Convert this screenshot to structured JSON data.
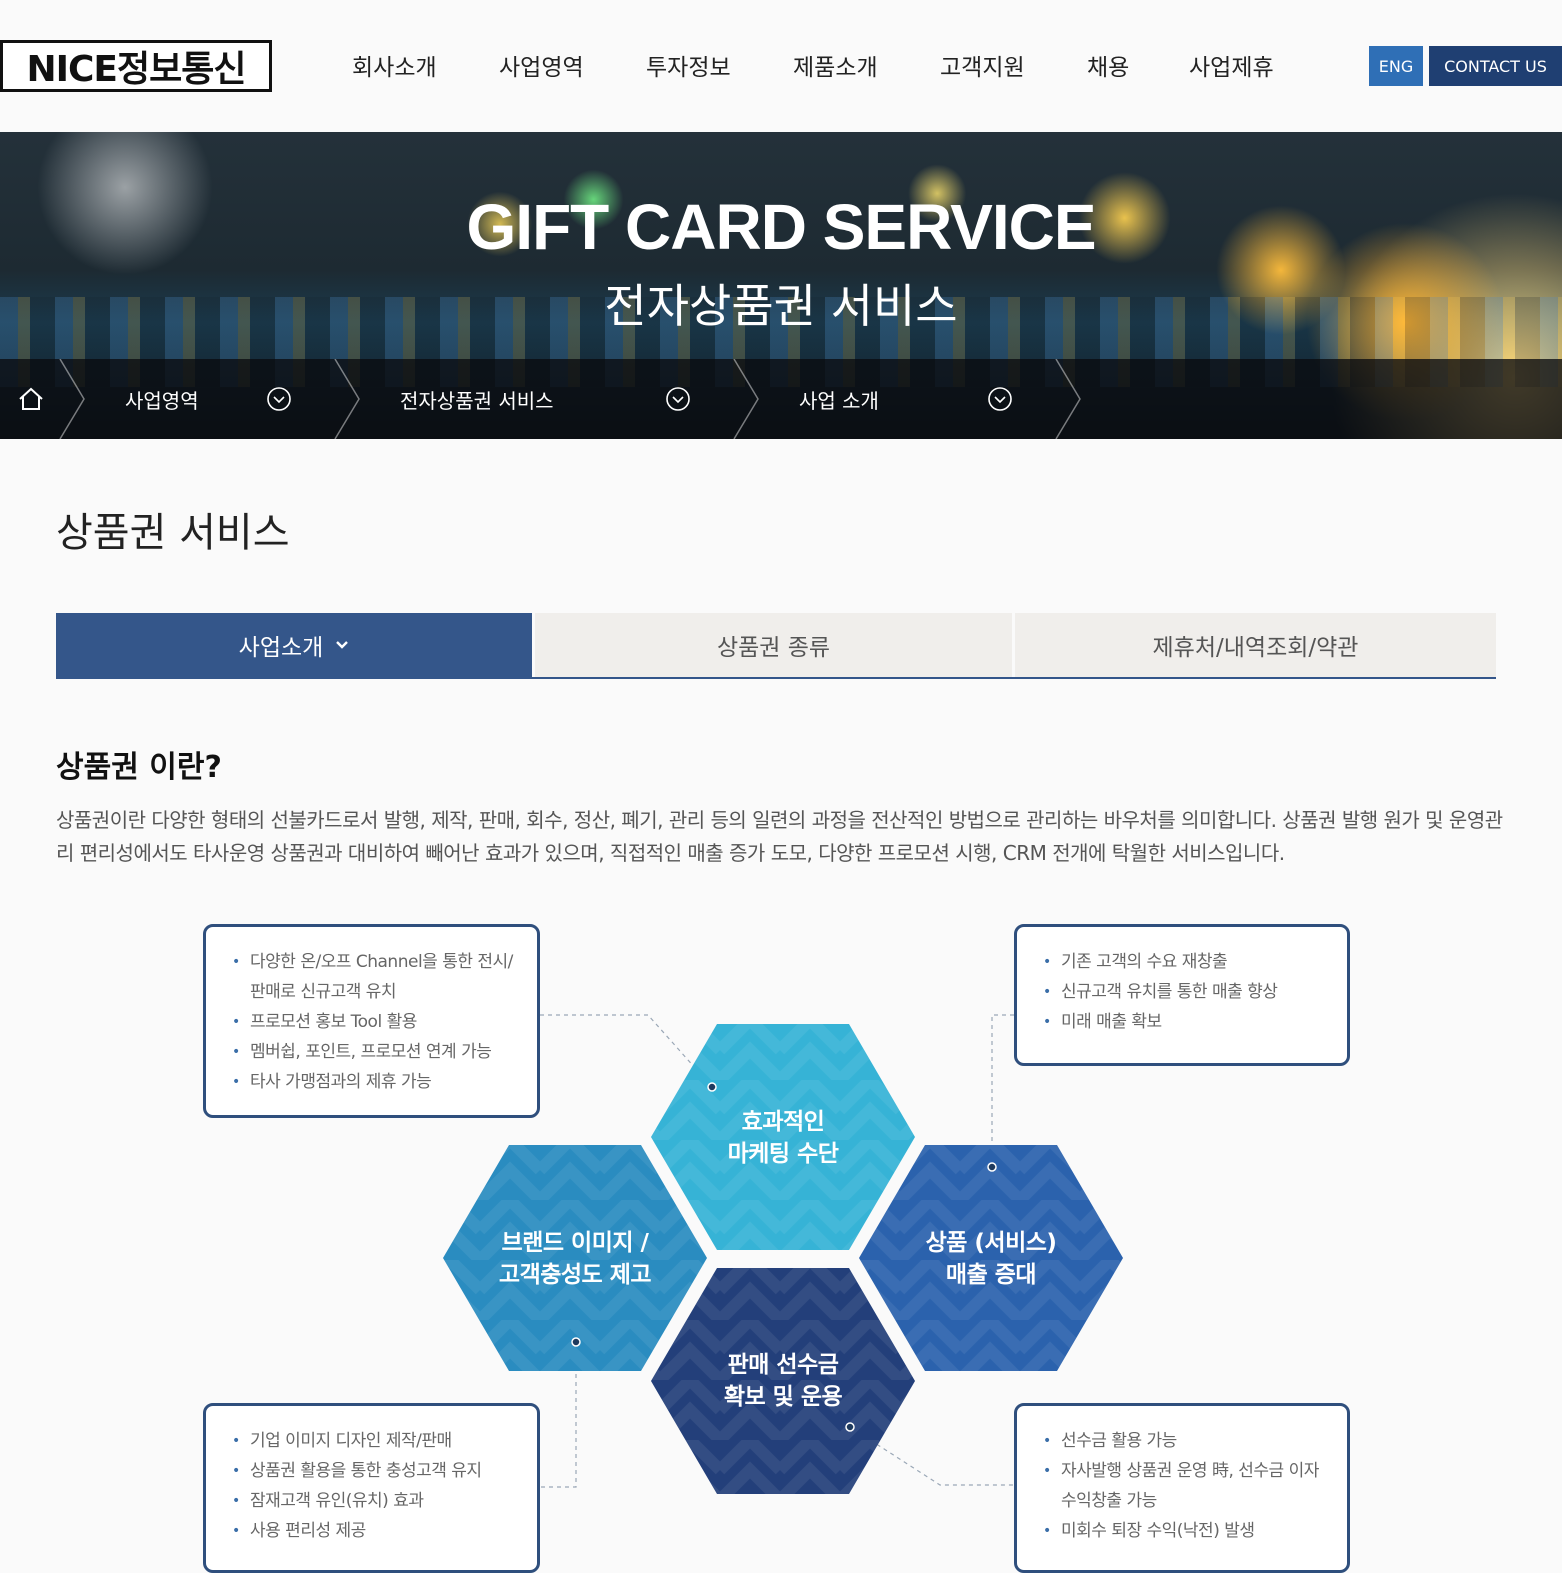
{
  "header": {
    "logo_text": "NICE정보통신",
    "nav": [
      "회사소개",
      "사업영역",
      "투자정보",
      "제품소개",
      "고객지원",
      "채용",
      "사업제휴"
    ],
    "eng_label": "ENG",
    "contact_label": "CONTACT US"
  },
  "hero": {
    "title": "GIFT CARD SERVICE",
    "subtitle": "전자상품권 서비스"
  },
  "breadcrumb": {
    "items": [
      "사업영역",
      "전자상품권 서비스",
      "사업 소개"
    ]
  },
  "page_title": "상품권 서비스",
  "tabs": [
    {
      "label": "사업소개"
    },
    {
      "label": "상품권 종류"
    },
    {
      "label": "제휴처/내역조회/약관"
    }
  ],
  "section": {
    "title": "상품권 이란?",
    "description": "상품권이란 다양한 형태의 선불카드로서 발행, 제작, 판매, 회수, 정산, 폐기, 관리 등의 일련의 과정을 전산적인 방법으로 관리하는 바우처를 의미합니다. 상품권 발행 원가 및 운영관리 편리성에서도 타사운영 상품권과 대비하여 빼어난 효과가 있으며, 직접적인 매출 증가 도모, 다양한 프로모션 시행, CRM 전개에 탁월한 서비스입니다."
  },
  "diagram": {
    "hexes": {
      "top": [
        "효과적인",
        "마케팅 수단"
      ],
      "left": [
        "브랜드 이미지 /",
        "고객충성도 제고"
      ],
      "right": [
        "상품 (서비스)",
        "매출 증대"
      ],
      "bottom": [
        "판매 선수금",
        "확보 및 운용"
      ]
    },
    "boxes": {
      "top_left": [
        "다양한 온/오프 Channel을 통한 전시/판매로 신규고객 유치",
        "프로모션 홍보 Tool 활용",
        "멤버쉽, 포인트, 프로모션 연계 가능",
        "타사 가맹점과의 제휴 가능"
      ],
      "top_right": [
        "기존 고객의 수요 재창출",
        "신규고객 유치를 통한 매출 향상",
        "미래 매출 확보"
      ],
      "bottom_left": [
        "기업 이미지 디자인 제작/판매",
        "상품권 활용을 통한 충성고객 유지",
        "잠재고객 유인(유치) 효과",
        "사용 편리성 제공"
      ],
      "bottom_right": [
        "선수금 활용 가능",
        "자사발행 상품권 운영 時, 선수금 이자 수익창출 가능",
        "미회수 퇴장 수익(낙전) 발생"
      ]
    },
    "colors": {
      "top": "#36b3d6",
      "left": "#2a8cc0",
      "right": "#2b62ad",
      "bottom": "#233f7a",
      "box_border": "#2f4f7d"
    }
  },
  "colors": {
    "tab_active": "#34568a",
    "eng_bg": "#2f6fb6",
    "contact_bg": "#1f3f72"
  }
}
